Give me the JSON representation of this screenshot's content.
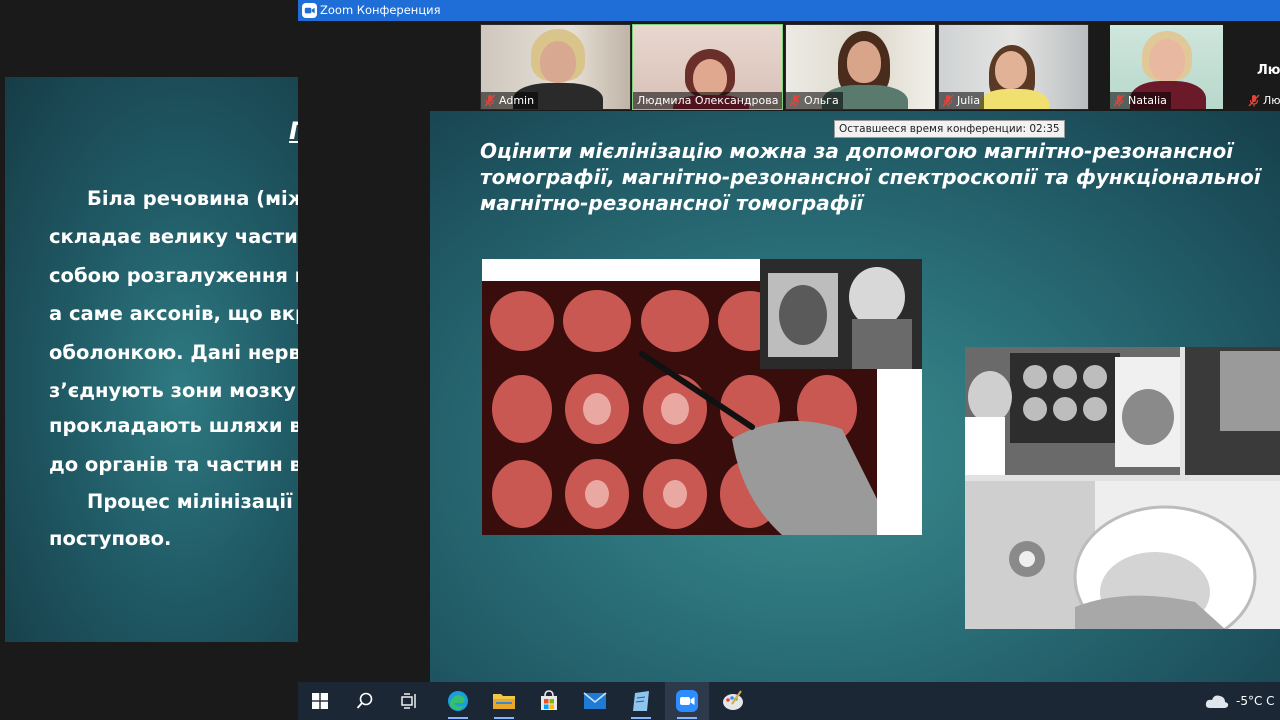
{
  "zoom": {
    "window_title": "Zoom Конференция",
    "remaining_time_tooltip": "Оставшееся время конференции: 02:35",
    "participants": [
      {
        "name": "Admin",
        "muted": true
      },
      {
        "name": "Людмила Олександрова",
        "muted": false
      },
      {
        "name": "Ольга",
        "muted": true
      },
      {
        "name": "Julia",
        "muted": true
      },
      {
        "name": "Natalia",
        "muted": true
      },
      {
        "name": "Лю",
        "muted": true
      }
    ],
    "next_tile_label": "Лю"
  },
  "left_slide": {
    "heading": "П",
    "lines": [
      "Біла речовина (міжз",
      "складає велику частин",
      "собою розгалуження ві",
      "а саме аксонів, що вкр",
      "оболонкою. Дані нерво",
      "з’єднують зони мозку м",
      "прокладають шляхи від",
      "до органів та частин во",
      "Процес мілінізації",
      "поступово."
    ]
  },
  "main_slide": {
    "title_lines": [
      "Оцінити  мієлінізацію можна за допомогою магнітно-резонансної",
      "томографії,  магнітно-резонансної спектроскопії та функціональної",
      "магнітно-резонансної томографії"
    ]
  },
  "taskbar": {
    "items": [
      "windows-start",
      "search",
      "task-view",
      "edge",
      "file-explorer",
      "microsoft-store",
      "mail",
      "notepad",
      "zoom",
      "paint"
    ],
    "temperature": "-5°C",
    "weather_text_clipped": "C"
  },
  "colors": {
    "zoom_blue": "#1f6dd6",
    "slide_teal": "#2a6f78",
    "mute_red": "#e0443a",
    "taskbar": "#1b2735"
  }
}
